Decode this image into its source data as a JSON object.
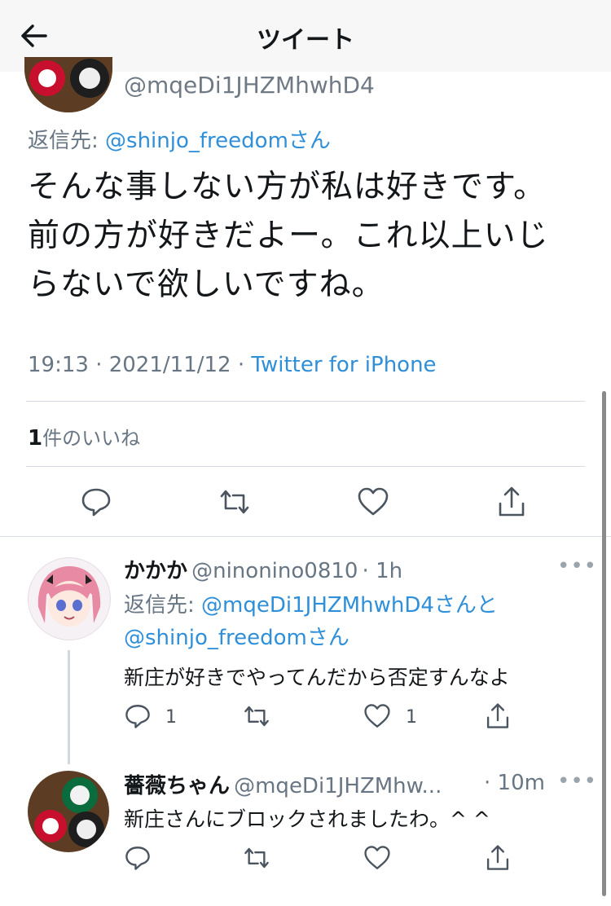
{
  "header": {
    "title": "ツイート"
  },
  "main_tweet": {
    "handle": "@mqeDi1JHZMhwhD4",
    "reply_label": "返信先: ",
    "reply_to": "@shinjo_freedomさん",
    "text_lines": [
      "そんな事しない方が私は好きです。",
      "前の方が好きだよー。これ以上いじ",
      "らないで欲しいですね。"
    ],
    "time": "19:13 · 2021/11/12 · ",
    "source": "Twitter for iPhone",
    "likes_count": "1",
    "likes_label": "件のいいね"
  },
  "reply1": {
    "name": "かかか",
    "handle": "@ninonino0810",
    "time": "· 1h",
    "reply_label": "返信先: ",
    "reply_to_1": "@mqeDi1JHZMhwhD4さんと",
    "reply_to_2": "@shinjo_freedomさん",
    "text": "新庄が好きでやってんだから否定すんなよ",
    "reply_count": "1",
    "like_count": "1"
  },
  "reply2": {
    "name": "薔薇ちゃん",
    "handle": "@mqeDi1JHZMhw...",
    "time": "· 10m",
    "text": "新庄さんにブロックされましたわ。^ ^"
  },
  "colors": {
    "link": "#2f8fd8",
    "muted": "#687684",
    "icon": "#4b5560"
  }
}
